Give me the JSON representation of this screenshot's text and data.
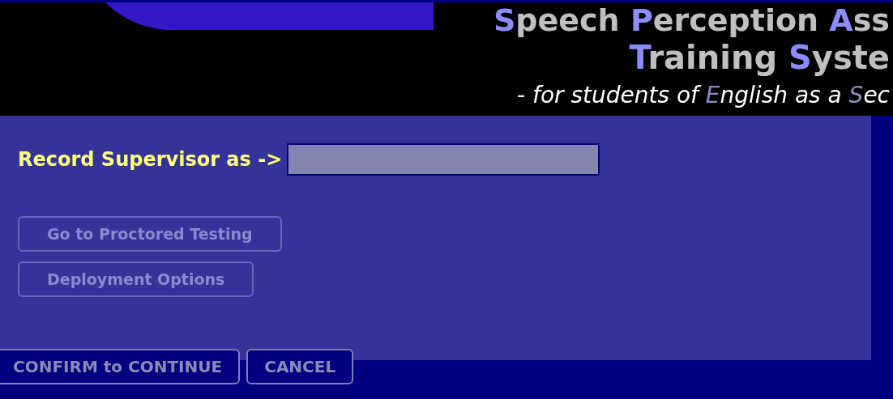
{
  "header": {
    "title_line_1": [
      {
        "text": "S",
        "accent": true
      },
      {
        "text": "peech ",
        "accent": false
      },
      {
        "text": "P",
        "accent": true
      },
      {
        "text": "erception ",
        "accent": false
      },
      {
        "text": "A",
        "accent": true
      },
      {
        "text": "ss",
        "accent": false
      }
    ],
    "title_line_2": [
      {
        "text": "T",
        "accent": true
      },
      {
        "text": "raining ",
        "accent": false
      },
      {
        "text": "S",
        "accent": true
      },
      {
        "text": "yste",
        "accent": false
      }
    ],
    "subtitle": [
      {
        "text": "- for students of ",
        "accent": false
      },
      {
        "text": "E",
        "accent": true
      },
      {
        "text": "nglish as a ",
        "accent": false
      },
      {
        "text": "S",
        "accent": true
      },
      {
        "text": "ec",
        "accent": false
      }
    ]
  },
  "form": {
    "label": "Record Supervisor as ->",
    "options": [
      {
        "label": "Go to Proctored Testing",
        "disabled": true
      },
      {
        "label": "Deployment Options",
        "disabled": true
      }
    ]
  },
  "actions": [
    {
      "label": "CONFIRM to CONTINUE",
      "disabled": false
    },
    {
      "label": "CANCEL",
      "disabled": false
    }
  ]
}
